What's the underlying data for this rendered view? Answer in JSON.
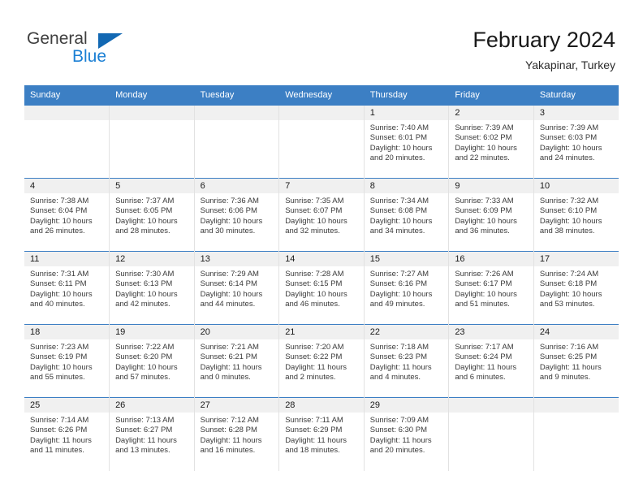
{
  "brand": {
    "name_part1": "General",
    "name_part2": "Blue",
    "triangle_icon": "triangle-icon",
    "accent_color": "#1268b3",
    "blue_color": "#1a7fd4"
  },
  "header": {
    "month_title": "February 2024",
    "location": "Yakapinar, Turkey"
  },
  "theme": {
    "header_blue": "#3c7fc4",
    "daynum_bg": "#f0f0f0",
    "body_text": "#3a3a3a"
  },
  "calendar": {
    "weekday_headers": [
      "Sunday",
      "Monday",
      "Tuesday",
      "Wednesday",
      "Thursday",
      "Friday",
      "Saturday"
    ],
    "weeks": [
      [
        {
          "day": "",
          "sunrise": "",
          "sunset": "",
          "daylight_line1": "",
          "daylight_line2": ""
        },
        {
          "day": "",
          "sunrise": "",
          "sunset": "",
          "daylight_line1": "",
          "daylight_line2": ""
        },
        {
          "day": "",
          "sunrise": "",
          "sunset": "",
          "daylight_line1": "",
          "daylight_line2": ""
        },
        {
          "day": "",
          "sunrise": "",
          "sunset": "",
          "daylight_line1": "",
          "daylight_line2": ""
        },
        {
          "day": "1",
          "sunrise": "Sunrise: 7:40 AM",
          "sunset": "Sunset: 6:01 PM",
          "daylight_line1": "Daylight: 10 hours",
          "daylight_line2": "and 20 minutes."
        },
        {
          "day": "2",
          "sunrise": "Sunrise: 7:39 AM",
          "sunset": "Sunset: 6:02 PM",
          "daylight_line1": "Daylight: 10 hours",
          "daylight_line2": "and 22 minutes."
        },
        {
          "day": "3",
          "sunrise": "Sunrise: 7:39 AM",
          "sunset": "Sunset: 6:03 PM",
          "daylight_line1": "Daylight: 10 hours",
          "daylight_line2": "and 24 minutes."
        }
      ],
      [
        {
          "day": "4",
          "sunrise": "Sunrise: 7:38 AM",
          "sunset": "Sunset: 6:04 PM",
          "daylight_line1": "Daylight: 10 hours",
          "daylight_line2": "and 26 minutes."
        },
        {
          "day": "5",
          "sunrise": "Sunrise: 7:37 AM",
          "sunset": "Sunset: 6:05 PM",
          "daylight_line1": "Daylight: 10 hours",
          "daylight_line2": "and 28 minutes."
        },
        {
          "day": "6",
          "sunrise": "Sunrise: 7:36 AM",
          "sunset": "Sunset: 6:06 PM",
          "daylight_line1": "Daylight: 10 hours",
          "daylight_line2": "and 30 minutes."
        },
        {
          "day": "7",
          "sunrise": "Sunrise: 7:35 AM",
          "sunset": "Sunset: 6:07 PM",
          "daylight_line1": "Daylight: 10 hours",
          "daylight_line2": "and 32 minutes."
        },
        {
          "day": "8",
          "sunrise": "Sunrise: 7:34 AM",
          "sunset": "Sunset: 6:08 PM",
          "daylight_line1": "Daylight: 10 hours",
          "daylight_line2": "and 34 minutes."
        },
        {
          "day": "9",
          "sunrise": "Sunrise: 7:33 AM",
          "sunset": "Sunset: 6:09 PM",
          "daylight_line1": "Daylight: 10 hours",
          "daylight_line2": "and 36 minutes."
        },
        {
          "day": "10",
          "sunrise": "Sunrise: 7:32 AM",
          "sunset": "Sunset: 6:10 PM",
          "daylight_line1": "Daylight: 10 hours",
          "daylight_line2": "and 38 minutes."
        }
      ],
      [
        {
          "day": "11",
          "sunrise": "Sunrise: 7:31 AM",
          "sunset": "Sunset: 6:11 PM",
          "daylight_line1": "Daylight: 10 hours",
          "daylight_line2": "and 40 minutes."
        },
        {
          "day": "12",
          "sunrise": "Sunrise: 7:30 AM",
          "sunset": "Sunset: 6:13 PM",
          "daylight_line1": "Daylight: 10 hours",
          "daylight_line2": "and 42 minutes."
        },
        {
          "day": "13",
          "sunrise": "Sunrise: 7:29 AM",
          "sunset": "Sunset: 6:14 PM",
          "daylight_line1": "Daylight: 10 hours",
          "daylight_line2": "and 44 minutes."
        },
        {
          "day": "14",
          "sunrise": "Sunrise: 7:28 AM",
          "sunset": "Sunset: 6:15 PM",
          "daylight_line1": "Daylight: 10 hours",
          "daylight_line2": "and 46 minutes."
        },
        {
          "day": "15",
          "sunrise": "Sunrise: 7:27 AM",
          "sunset": "Sunset: 6:16 PM",
          "daylight_line1": "Daylight: 10 hours",
          "daylight_line2": "and 49 minutes."
        },
        {
          "day": "16",
          "sunrise": "Sunrise: 7:26 AM",
          "sunset": "Sunset: 6:17 PM",
          "daylight_line1": "Daylight: 10 hours",
          "daylight_line2": "and 51 minutes."
        },
        {
          "day": "17",
          "sunrise": "Sunrise: 7:24 AM",
          "sunset": "Sunset: 6:18 PM",
          "daylight_line1": "Daylight: 10 hours",
          "daylight_line2": "and 53 minutes."
        }
      ],
      [
        {
          "day": "18",
          "sunrise": "Sunrise: 7:23 AM",
          "sunset": "Sunset: 6:19 PM",
          "daylight_line1": "Daylight: 10 hours",
          "daylight_line2": "and 55 minutes."
        },
        {
          "day": "19",
          "sunrise": "Sunrise: 7:22 AM",
          "sunset": "Sunset: 6:20 PM",
          "daylight_line1": "Daylight: 10 hours",
          "daylight_line2": "and 57 minutes."
        },
        {
          "day": "20",
          "sunrise": "Sunrise: 7:21 AM",
          "sunset": "Sunset: 6:21 PM",
          "daylight_line1": "Daylight: 11 hours",
          "daylight_line2": "and 0 minutes."
        },
        {
          "day": "21",
          "sunrise": "Sunrise: 7:20 AM",
          "sunset": "Sunset: 6:22 PM",
          "daylight_line1": "Daylight: 11 hours",
          "daylight_line2": "and 2 minutes."
        },
        {
          "day": "22",
          "sunrise": "Sunrise: 7:18 AM",
          "sunset": "Sunset: 6:23 PM",
          "daylight_line1": "Daylight: 11 hours",
          "daylight_line2": "and 4 minutes."
        },
        {
          "day": "23",
          "sunrise": "Sunrise: 7:17 AM",
          "sunset": "Sunset: 6:24 PM",
          "daylight_line1": "Daylight: 11 hours",
          "daylight_line2": "and 6 minutes."
        },
        {
          "day": "24",
          "sunrise": "Sunrise: 7:16 AM",
          "sunset": "Sunset: 6:25 PM",
          "daylight_line1": "Daylight: 11 hours",
          "daylight_line2": "and 9 minutes."
        }
      ],
      [
        {
          "day": "25",
          "sunrise": "Sunrise: 7:14 AM",
          "sunset": "Sunset: 6:26 PM",
          "daylight_line1": "Daylight: 11 hours",
          "daylight_line2": "and 11 minutes."
        },
        {
          "day": "26",
          "sunrise": "Sunrise: 7:13 AM",
          "sunset": "Sunset: 6:27 PM",
          "daylight_line1": "Daylight: 11 hours",
          "daylight_line2": "and 13 minutes."
        },
        {
          "day": "27",
          "sunrise": "Sunrise: 7:12 AM",
          "sunset": "Sunset: 6:28 PM",
          "daylight_line1": "Daylight: 11 hours",
          "daylight_line2": "and 16 minutes."
        },
        {
          "day": "28",
          "sunrise": "Sunrise: 7:11 AM",
          "sunset": "Sunset: 6:29 PM",
          "daylight_line1": "Daylight: 11 hours",
          "daylight_line2": "and 18 minutes."
        },
        {
          "day": "29",
          "sunrise": "Sunrise: 7:09 AM",
          "sunset": "Sunset: 6:30 PM",
          "daylight_line1": "Daylight: 11 hours",
          "daylight_line2": "and 20 minutes."
        },
        {
          "day": "",
          "sunrise": "",
          "sunset": "",
          "daylight_line1": "",
          "daylight_line2": ""
        },
        {
          "day": "",
          "sunrise": "",
          "sunset": "",
          "daylight_line1": "",
          "daylight_line2": ""
        }
      ]
    ]
  }
}
